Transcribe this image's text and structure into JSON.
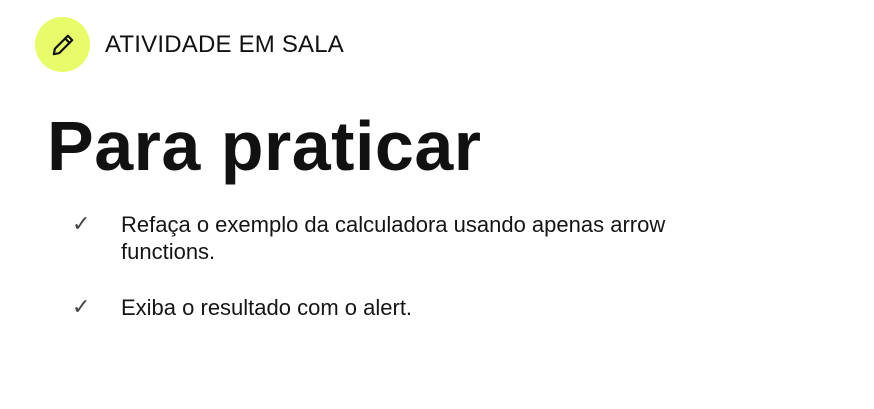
{
  "header": {
    "icon": "pencil-icon",
    "badge_color": "#e8fb6a",
    "label": "ATIVIDADE EM SALA"
  },
  "title": "Para praticar",
  "items": [
    {
      "icon": "checkmark-icon",
      "check": "✓",
      "text": "Refaça o exemplo da calculadora usando apenas arrow functions."
    },
    {
      "icon": "checkmark-icon",
      "check": "✓",
      "text": "Exiba o resultado com o alert."
    }
  ]
}
